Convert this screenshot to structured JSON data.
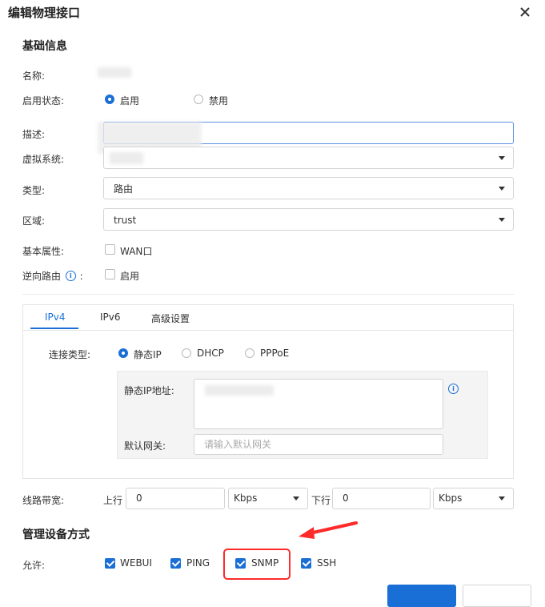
{
  "dialog": {
    "title": "编辑物理接口"
  },
  "basic": {
    "section_title": "基础信息",
    "name_label": "名称:",
    "status_label": "启用状态:",
    "status_options": [
      "启用",
      "禁用"
    ],
    "desc_label": "描述:",
    "vsys_label": "虚拟系统:",
    "type_label": "类型:",
    "type_value": "路由",
    "zone_label": "区域:",
    "zone_value": "trust",
    "attr_label": "基本属性:",
    "attr_option": "WAN口",
    "reverse_label": "逆向路由",
    "reverse_suffix": ":",
    "reverse_option": "启用"
  },
  "tabs": [
    "IPv4",
    "IPv6",
    "高级设置"
  ],
  "ipv4": {
    "conn_label": "连接类型:",
    "conn_options": [
      "静态IP",
      "DHCP",
      "PPPoE"
    ],
    "static_ip_label": "静态IP地址:",
    "gateway_label": "默认网关:",
    "gateway_placeholder": "请输入默认网关"
  },
  "bandwidth": {
    "label": "线路带宽:",
    "up_label": "上行",
    "up_value": "0",
    "up_unit": "Kbps",
    "down_label": "下行",
    "down_value": "0",
    "down_unit": "Kbps"
  },
  "manage": {
    "section_title": "管理设备方式",
    "allow_label": "允许:",
    "options": [
      "WEBUI",
      "PING",
      "SNMP",
      "SSH"
    ]
  },
  "icons": {
    "close": "close-icon",
    "info": "info-icon",
    "dropdown": "chevron-down-icon",
    "annotation": "red-arrow-icon"
  },
  "colors": {
    "accent": "#1a6fd6",
    "annotation": "#ff2a2a"
  }
}
